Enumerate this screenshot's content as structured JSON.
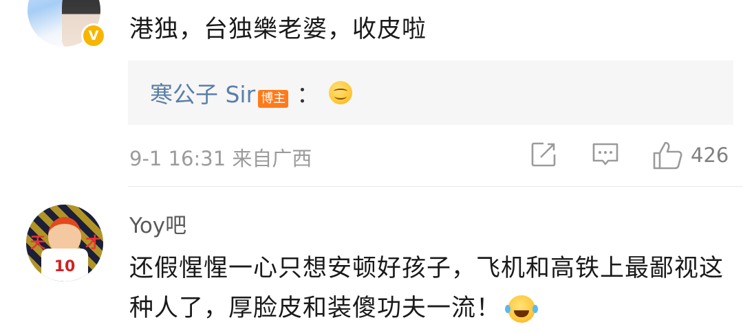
{
  "comment1": {
    "text": "港独，台独樂老婆，收皮啦",
    "verified_badge": "V",
    "reply": {
      "author": "寒公子 Sir",
      "author_badge": "博主",
      "separator": "：",
      "emoji": "smile-emoji"
    },
    "meta": "9-1 16:31 来自广西",
    "like_count": "426"
  },
  "comment2": {
    "username": "Yoy吧",
    "text": "还假惺惺一心只想安顿好孩子，飞机和高铁上最鄙视这种人了，厚脸皮和装傻功夫一流！",
    "emoji": "tears-of-joy-emoji",
    "avatar_text_left": "天",
    "avatar_text_right": "才",
    "avatar_jersey": "10"
  },
  "colors": {
    "username_link": "#5b7fa8",
    "author_badge_bg": "#ff7a1a",
    "verified_badge_bg": "#f7b500",
    "meta_gray": "#9b9b9b",
    "reply_box_bg": "#f6f6f6"
  }
}
